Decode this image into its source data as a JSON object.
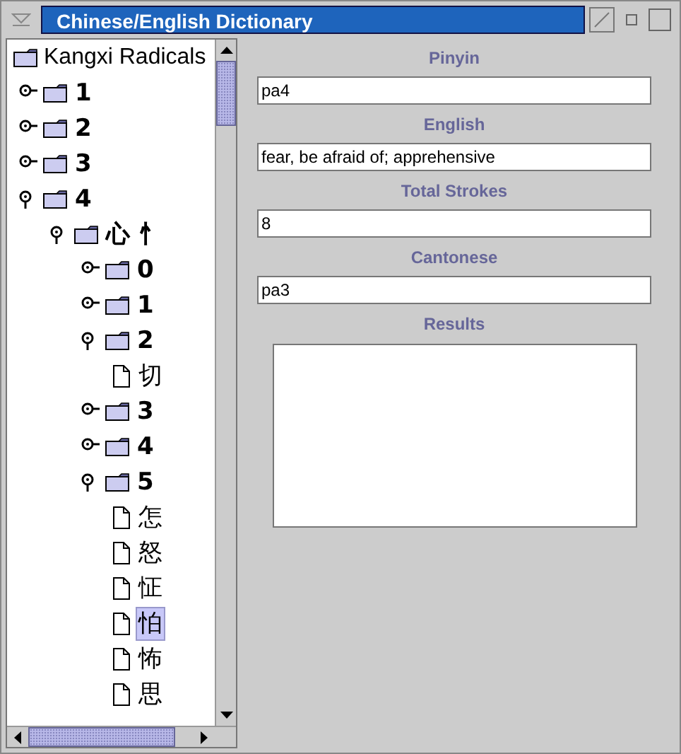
{
  "window": {
    "title": "Chinese/English Dictionary"
  },
  "tree": {
    "label": "Kangxi Radicals",
    "kind": "folder",
    "children": [
      {
        "label": "1",
        "kind": "folder",
        "expanded": false
      },
      {
        "label": "2",
        "kind": "folder",
        "expanded": false
      },
      {
        "label": "3",
        "kind": "folder",
        "expanded": false
      },
      {
        "label": "4",
        "kind": "folder",
        "expanded": true,
        "children": [
          {
            "label": "心 忄",
            "kind": "folder",
            "expanded": true,
            "children": [
              {
                "label": "0",
                "kind": "folder",
                "expanded": false
              },
              {
                "label": "1",
                "kind": "folder",
                "expanded": false
              },
              {
                "label": "2",
                "kind": "folder",
                "expanded": true,
                "children": [
                  {
                    "label": "切",
                    "kind": "leaf",
                    "selected": false
                  }
                ]
              },
              {
                "label": "3",
                "kind": "folder",
                "expanded": false
              },
              {
                "label": "4",
                "kind": "folder",
                "expanded": false
              },
              {
                "label": "5",
                "kind": "folder",
                "expanded": true,
                "children": [
                  {
                    "label": "怎",
                    "kind": "leaf",
                    "selected": false
                  },
                  {
                    "label": "怒",
                    "kind": "leaf",
                    "selected": false
                  },
                  {
                    "label": "怔",
                    "kind": "leaf",
                    "selected": false
                  },
                  {
                    "label": "怕",
                    "kind": "leaf",
                    "selected": true
                  },
                  {
                    "label": "怖",
                    "kind": "leaf",
                    "selected": false
                  },
                  {
                    "label": "思",
                    "kind": "leaf",
                    "selected": false
                  }
                ]
              }
            ]
          }
        ]
      }
    ]
  },
  "fields": [
    {
      "label": "Pinyin",
      "value": "pa4"
    },
    {
      "label": "English",
      "value": "fear, be afraid of; apprehensive"
    },
    {
      "label": "Total Strokes",
      "value": "8"
    },
    {
      "label": "Cantonese",
      "value": "pa3"
    }
  ],
  "results": {
    "label": "Results"
  }
}
